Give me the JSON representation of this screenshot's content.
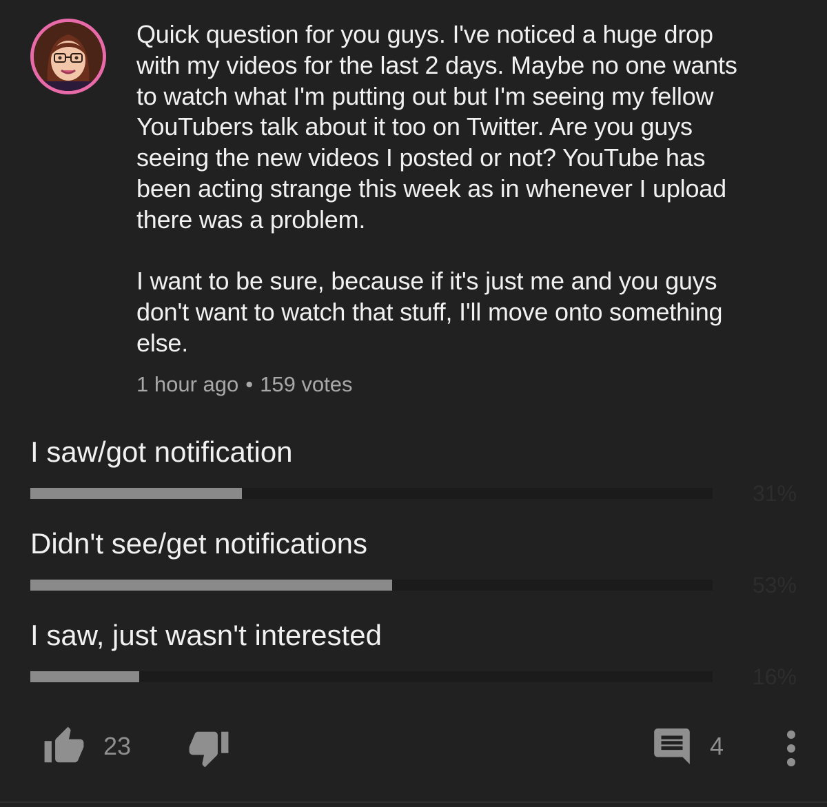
{
  "post": {
    "text": "Quick question for you guys. I've noticed a huge drop\nwith my videos for the last 2 days. Maybe no one wants\nto watch what I'm putting out but I'm seeing my fellow\nYouTubers talk about it too on Twitter. Are you guys\nseeing the new videos I posted or not? YouTube has\nbeen acting strange this week as in whenever I upload\nthere was a problem.\n\nI want to be sure, because if it's just me and you guys\ndon't want to watch that stuff, I'll move onto something\nelse.",
    "time": "1 hour ago",
    "separator": "•",
    "votes": "159 votes"
  },
  "poll": {
    "options": [
      {
        "label": "I saw/got notification",
        "percent_label": "31%",
        "percent": 31
      },
      {
        "label": "Didn't see/get notifications",
        "percent_label": "53%",
        "percent": 53
      },
      {
        "label": "I saw, just wasn't interested",
        "percent_label": "16%",
        "percent": 16
      }
    ]
  },
  "actions": {
    "like_count": "23",
    "comment_count": "4",
    "like_icon": "thumb-up-icon",
    "dislike_icon": "thumb-down-icon",
    "comment_icon": "comment-icon",
    "more_icon": "more-vertical-icon"
  },
  "colors": {
    "background": "#212121",
    "avatar_ring": "#e86aa8",
    "bar_fill": "#8a8a8a",
    "bar_track": "#1b1b1b",
    "meta_text": "#a8a8a8"
  }
}
